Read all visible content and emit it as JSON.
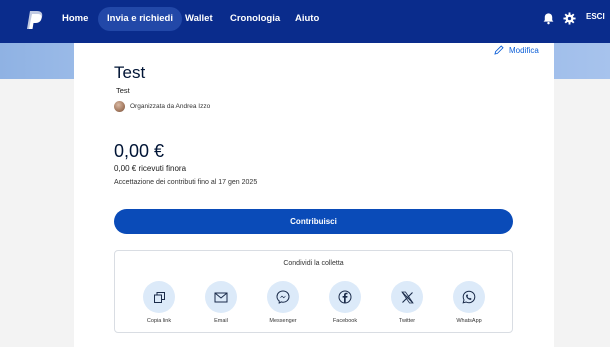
{
  "nav": {
    "items": [
      {
        "label": "Home",
        "active": false
      },
      {
        "label": "Invia e richiedi",
        "active": true
      },
      {
        "label": "Wallet",
        "active": false
      },
      {
        "label": "Cronologia",
        "active": false
      },
      {
        "label": "Aiuto",
        "active": false
      }
    ],
    "right_icons": [
      "bell-icon",
      "gear-icon"
    ],
    "logout_label": "ESCI",
    "colors": {
      "bar": "#0a2c8c",
      "active_pill": "#2248a8"
    }
  },
  "collection": {
    "edit_label": "Modifica",
    "title": "Test",
    "description": "Test",
    "organizer_text": "Organizzata da Andrea Izzo",
    "amount": "0,00 €",
    "received_text": "0,00 € ricevuti finora",
    "deadline_text": "Accettazione dei contributi fino al 17 gen 2025",
    "contribute_label": "Contribuisci",
    "accent_color": "#0a4bb8"
  },
  "share": {
    "title": "Condividi la colletta",
    "options": [
      {
        "label": "Copia link",
        "icon": "copy-icon"
      },
      {
        "label": "Email",
        "icon": "email-icon"
      },
      {
        "label": "Messenger",
        "icon": "messenger-icon"
      },
      {
        "label": "Facebook",
        "icon": "facebook-icon"
      },
      {
        "label": "Twitter",
        "icon": "x-icon"
      },
      {
        "label": "WhatsApp",
        "icon": "whatsapp-icon"
      }
    ]
  }
}
